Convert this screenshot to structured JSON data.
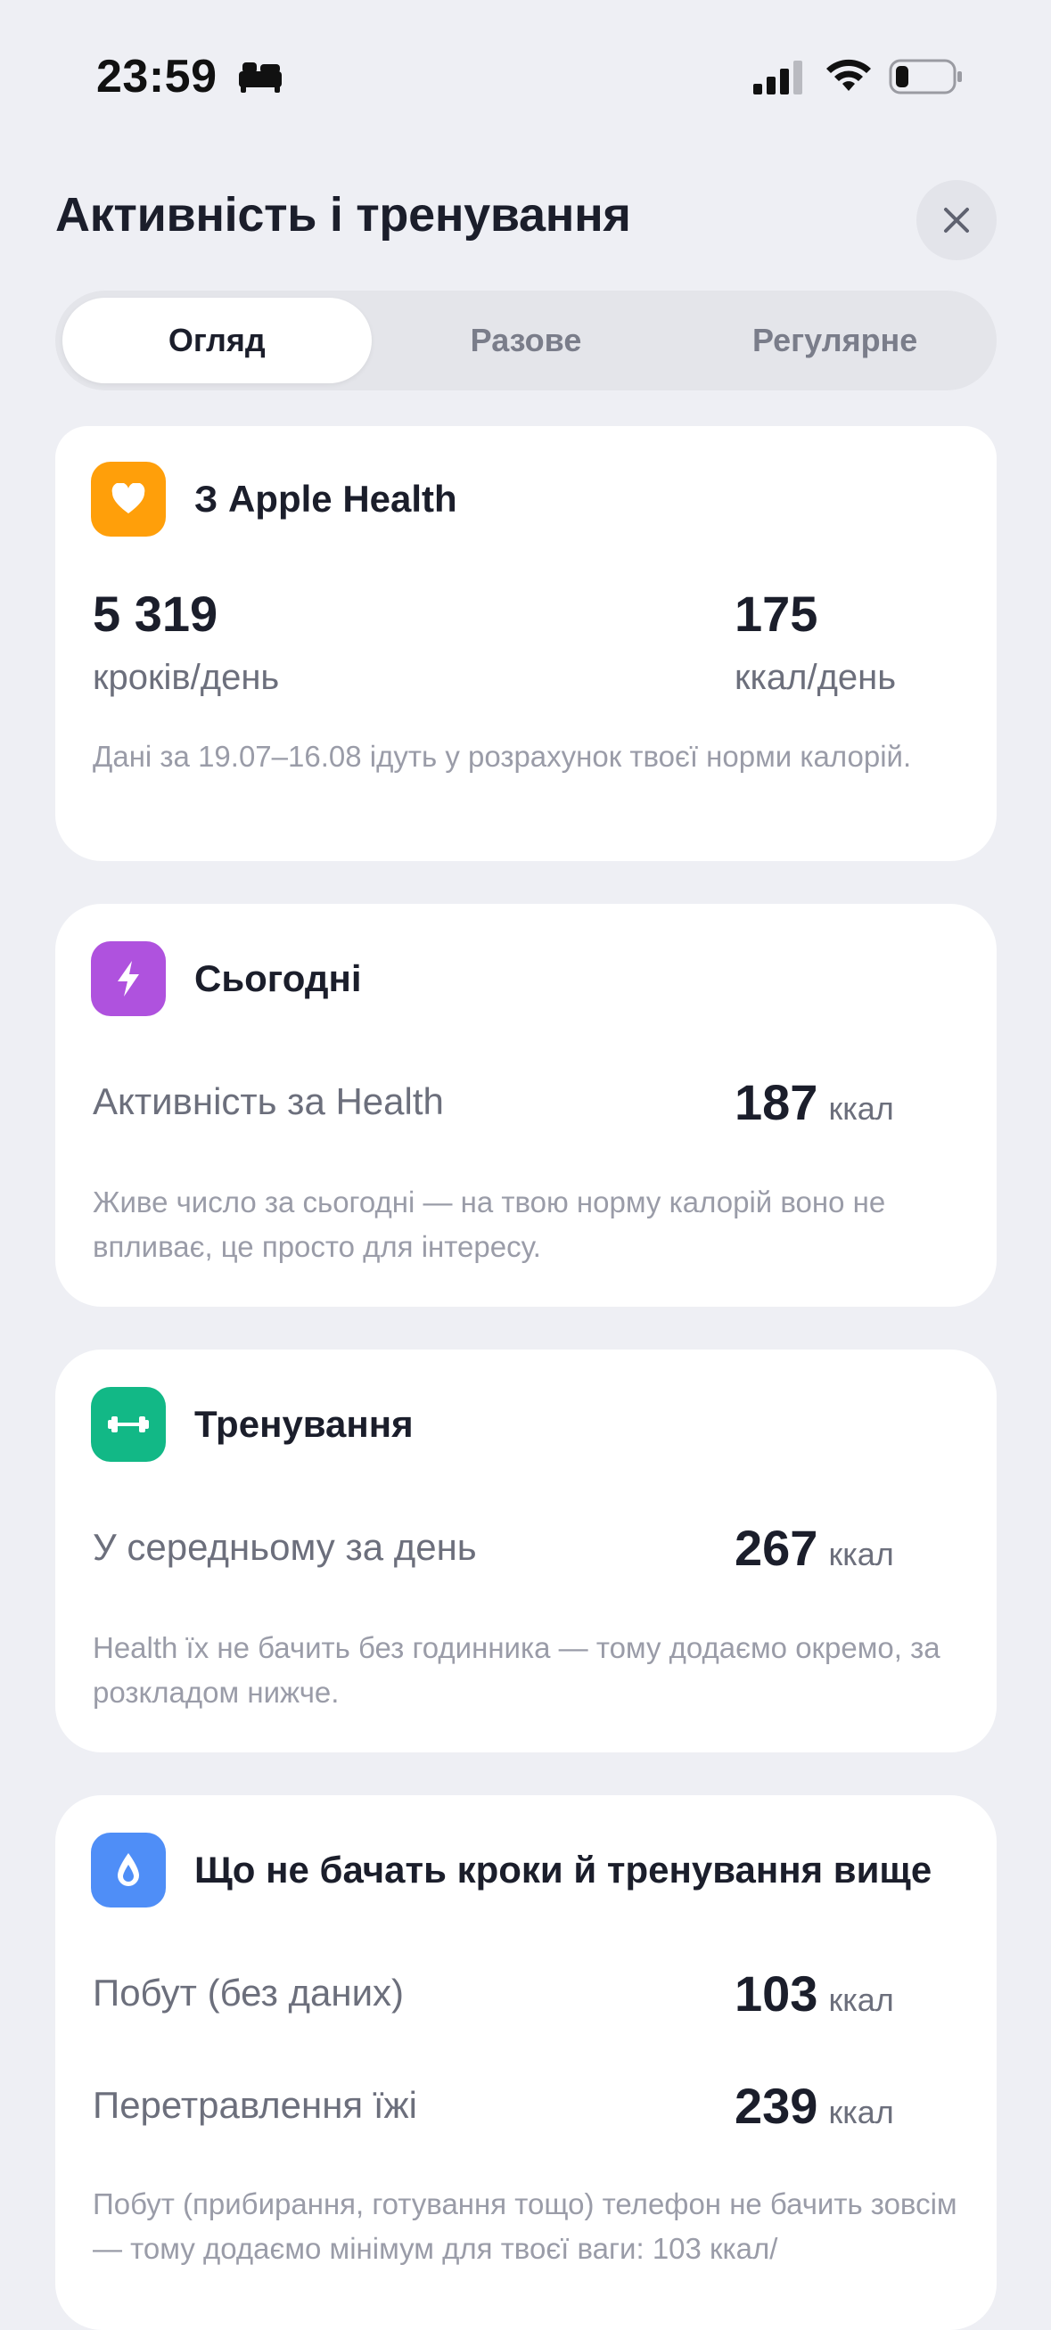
{
  "status": {
    "time": "23:59"
  },
  "header": {
    "title": "Активність і тренування"
  },
  "tabs": [
    {
      "label": "Огляд"
    },
    {
      "label": "Разове"
    },
    {
      "label": "Регулярне"
    }
  ],
  "health_card": {
    "title": "З Apple Health",
    "icon": "heart-icon",
    "color": "#FF9F0A",
    "steps_value": "5 319",
    "steps_label": "кроків/день",
    "kcal_value": "175",
    "kcal_label": "ккал/день",
    "note": "Дані за 19.07–16.08 ідуть у розрахунок твоєї норми калорій."
  },
  "today_card": {
    "title": "Сьогодні",
    "icon": "bolt-icon",
    "color": "#AF52DE",
    "row_label": "Активність за Health",
    "row_value": "187",
    "row_unit": "ккал",
    "note": "Живе число за сьогодні — на твою норму калорій воно не впливає, це просто для інтересу."
  },
  "workout_card": {
    "title": "Тренування",
    "icon": "dumbbell-icon",
    "color": "#12B886",
    "row_label": "У середньому за день",
    "row_value": "267",
    "row_unit": "ккал",
    "note": "Health їх не бачить без годинника — тому додаємо окремо, за розкладом нижче."
  },
  "hidden_card": {
    "title": "Що не бачать кроки й тренування вище",
    "icon": "drop-icon",
    "color": "#4F8EF7",
    "rows": [
      {
        "label": "Побут (без даних)",
        "value": "103",
        "unit": "ккал"
      },
      {
        "label": "Перетравлення їжі",
        "value": "239",
        "unit": "ккал"
      }
    ],
    "note": "Побут (прибирання, готування тощо) телефон не бачить зовсім — тому додаємо мінімум для твоєї ваги: 103 ккал/"
  }
}
